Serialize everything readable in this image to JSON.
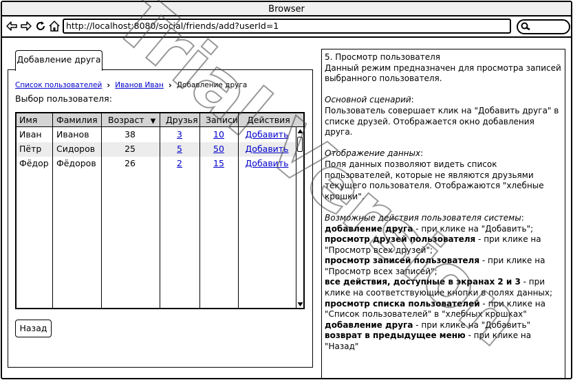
{
  "window": {
    "title": "Browser"
  },
  "navbar": {
    "url": "http://localhost:8080/social/friends/add?userId=1"
  },
  "left": {
    "tab_label": "Добавление друга",
    "breadcrumb": {
      "item1": "Список пользователей",
      "item2": "Иванов Иван",
      "current": "Добавление друга"
    },
    "subtitle": "Выбор пользователя:",
    "table": {
      "headers": {
        "name": "Имя",
        "surname": "Фамилия",
        "age": "Возраст",
        "friends": "Друзья",
        "posts": "Записи",
        "actions": "Действия"
      },
      "rows": [
        {
          "name": "Иван",
          "surname": "Иванов",
          "age": "38",
          "friends": "3",
          "posts": "10",
          "action": "Добавить"
        },
        {
          "name": "Пётр",
          "surname": "Сидоров",
          "age": "25",
          "friends": "5",
          "posts": "50",
          "action": "Добавить"
        },
        {
          "name": "Фёдор",
          "surname": "Фёдоров",
          "age": "26",
          "friends": "2",
          "posts": "15",
          "action": "Добавить"
        }
      ]
    },
    "back_label": "Назад"
  },
  "right": {
    "title": "5. Просмотр пользователя",
    "intro": "Данный режим предназначен для просмотра записей выбранного пользователя.",
    "scenario_heading": "Основной сценарий",
    "scenario_text": "Пользователь совершает клик на \"Добавить друга\" в списке друзей. Отображается окно добавления друга.",
    "display_heading": "Отображение данных",
    "display_text": "Поля данных позволяют видеть список пользователей, которые не являются друзьями текущего пользователя. Отображаются \"хлебные крошки\".",
    "actions_heading": "Возможные действия пользователя системы",
    "actions": [
      {
        "bold": "добавление друга",
        "text": " - при клике на \"Добавить\";"
      },
      {
        "bold": "просмотр друзей пользователя",
        "text": " - при клике на \"Просмотр всех друзей\";"
      },
      {
        "bold": "просмотр записей пользователя",
        "text": " - при клике на \"Просмотр всех записей\";"
      },
      {
        "bold": "все действия, доступные в экранах 2 и 3",
        "text": " - при клике на соответствующие кнопки в полях данных;"
      },
      {
        "bold": "просмотр списка пользователей",
        "text": " - при клике на \"Список пользователей\" в \"хлебных крошках\""
      },
      {
        "bold": "добавление друга",
        "text": " - при клике на \"Добавить\""
      },
      {
        "bold": "возврат в предыдущее меню",
        "text": " - при клике на \"Назад\""
      }
    ]
  },
  "watermark": "Trial Version"
}
